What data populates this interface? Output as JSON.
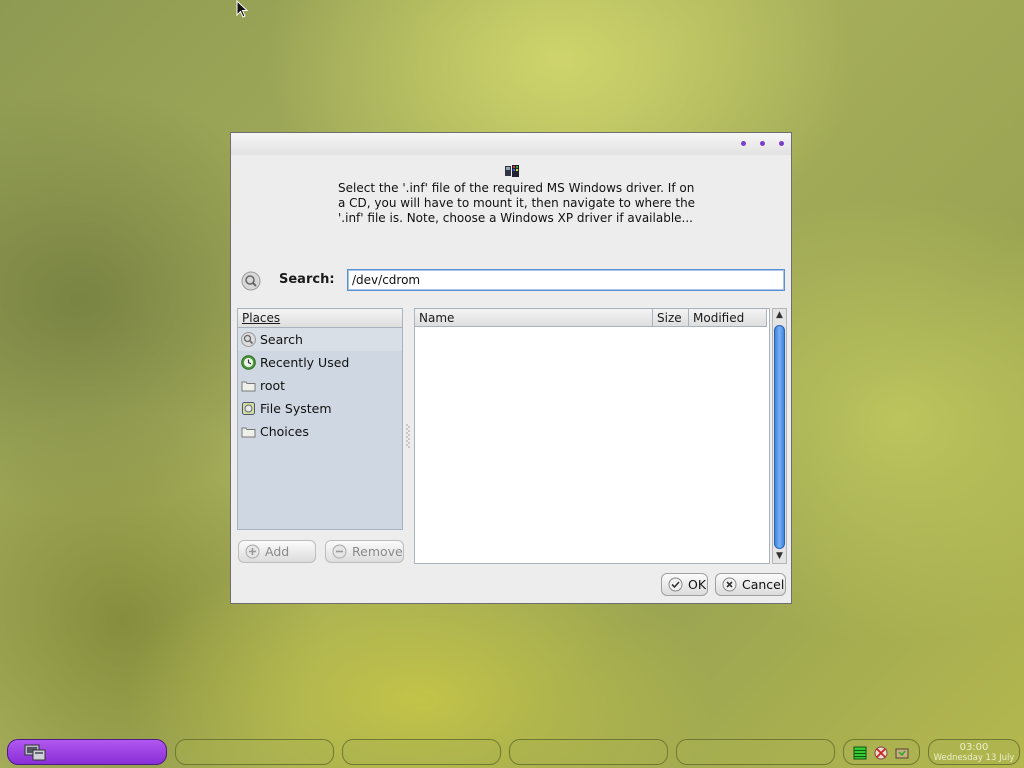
{
  "dialog": {
    "message": "Select the '.inf' file of the required MS Windows driver. If on a CD, you will have to mount it, then navigate to where the '.inf' file is. Note, choose a Windows XP driver if available...",
    "search_label": "Search:",
    "search_value": "/dev/cdrom"
  },
  "places": {
    "header": "Places",
    "items": [
      {
        "label": "Search",
        "icon": "search-icon"
      },
      {
        "label": "Recently Used",
        "icon": "recent-icon"
      },
      {
        "label": "root",
        "icon": "folder-icon"
      },
      {
        "label": "File System",
        "icon": "drive-icon"
      },
      {
        "label": "Choices",
        "icon": "folder-icon"
      }
    ],
    "add_label": "Add",
    "remove_label": "Remove"
  },
  "files": {
    "columns": [
      "Name",
      "Size",
      "Modified"
    ],
    "rows": []
  },
  "buttons": {
    "ok_label": "OK",
    "cancel_label": "Cancel"
  },
  "taskbar": {
    "clock_time": "03:00",
    "clock_date": "Wednesday 13 July"
  },
  "colors": {
    "accent": "#8a2ed8",
    "focus": "#5a8fd0",
    "scroll": "#3e84e0"
  }
}
